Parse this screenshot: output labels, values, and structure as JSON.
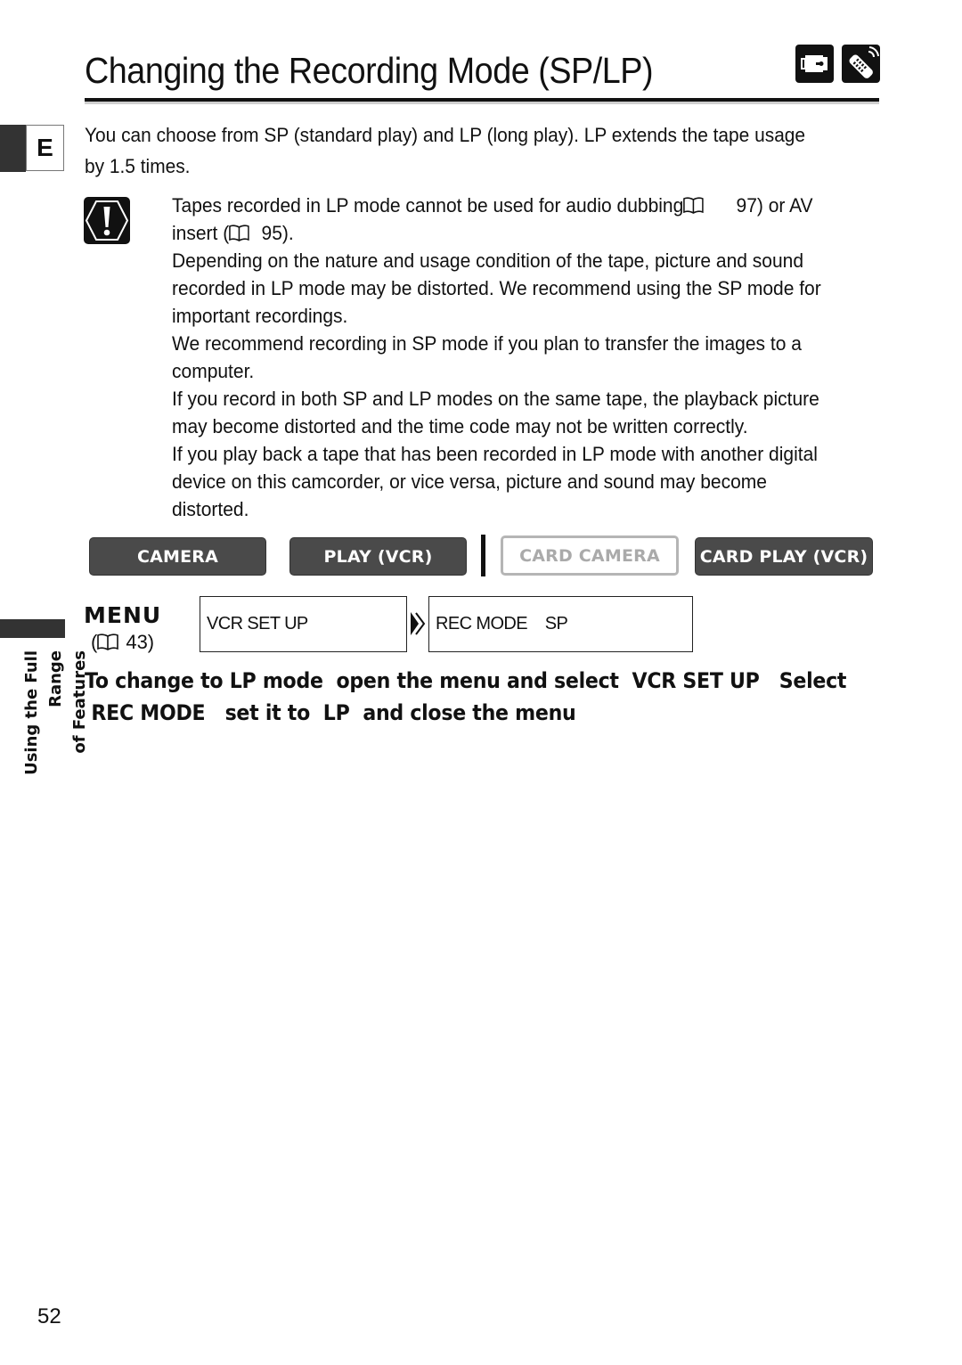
{
  "header": {
    "title": "Changing the Recording Mode (SP/LP)",
    "icons": [
      "camcorder-icon",
      "remote-control-icon"
    ]
  },
  "side_tab": {
    "language_letter": "E",
    "section_line1": "Using the Full Range",
    "section_line2": "of Features"
  },
  "intro": "You can choose from SP (standard play) and LP (long play). LP extends the tape usage by 1.5 times.",
  "notes": {
    "icon": "caution-icon",
    "line1_a": "Tapes recorded in LP mode cannot be used for audio dubbing",
    "line1_ref": "97) or AV",
    "line2_a": "insert (",
    "line2_ref": "95).",
    "line3": "Depending on the nature and usage condition of the tape, picture and sound",
    "line4": "recorded in LP mode may be distorted. We recommend using the SP mode for",
    "line5": "important recordings.",
    "line6": "We recommend recording in SP mode if you plan to transfer the images to a",
    "line7": "computer.",
    "line8": "If you record in both SP and LP modes on the same tape, the playback picture",
    "line9": "may become distorted and the time code may not be written correctly.",
    "line10": "If you play back a tape that has been recorded in LP mode with another digital",
    "line11": "device on this camcorder, or vice versa, picture and sound may become",
    "line12": "distorted."
  },
  "modes": [
    {
      "label": "CAMERA",
      "active": true
    },
    {
      "label": "PLAY (VCR)",
      "active": true
    },
    {
      "label": "CARD CAMERA",
      "active": false
    },
    {
      "label": "CARD PLAY (VCR)",
      "active": true
    }
  ],
  "menu": {
    "label": "MENU",
    "ref_open": "(",
    "ref_page": "43)",
    "step1": "VCR SET UP",
    "step2": "REC MODE    SP"
  },
  "instruction": {
    "line1": "To change to LP mode  open the menu and select  VCR SET UP   Select",
    "line2": " REC MODE   set it to  LP  and close the menu"
  },
  "page_number": "52",
  "colors": {
    "active_mode_bg": "#4a4a4a",
    "inactive_mode_border": "#b5b5b5",
    "text": "#111111"
  }
}
